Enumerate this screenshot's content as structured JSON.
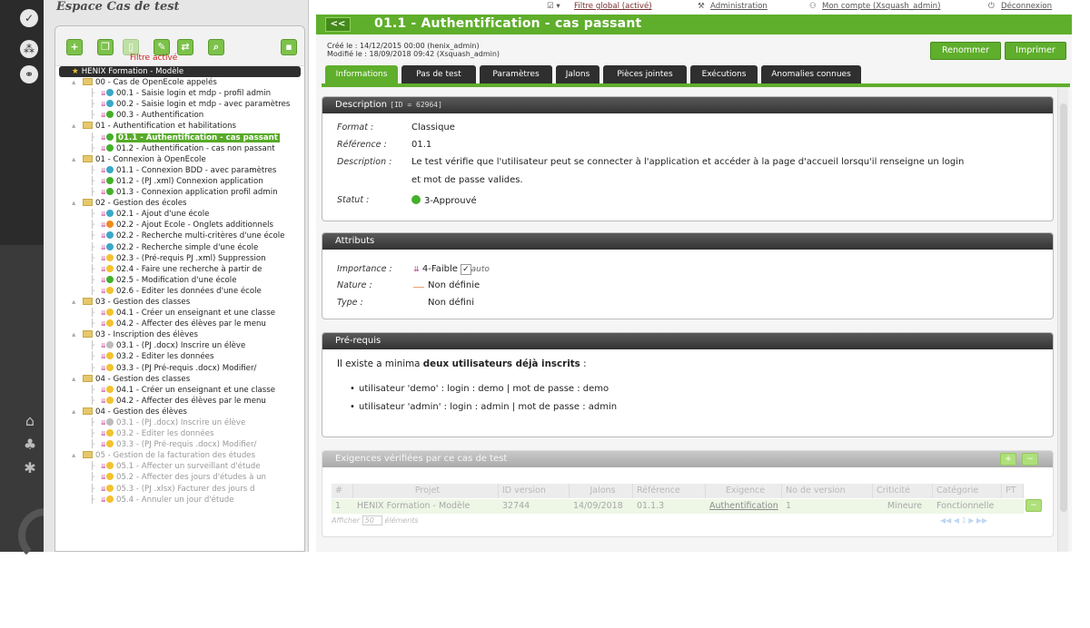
{
  "app": {
    "space_title": "Espace Cas de test",
    "filter_label": "Filtre activé"
  },
  "topbar": {
    "global_filter": "Filtre global (activé)",
    "administration": "Administration",
    "account": "Mon compte (Xsquash_admin)",
    "logout": "Déconnexion"
  },
  "header": {
    "back_label": "<<",
    "title": "01.1 - Authentification - cas passant",
    "created": "Créé le : 14/12/2015 00:00 (henix_admin)",
    "modified": "Modifié le : 18/09/2018 09:42 (Xsquash_admin)",
    "rename_label": "Renommer",
    "print_label": "Imprimer"
  },
  "tabs": [
    "Informations",
    "Pas de test",
    "Paramètres",
    "Jalons",
    "Pièces jointes",
    "Exécutions",
    "Anomalies connues"
  ],
  "description": {
    "heading": "Description",
    "id_label": "[ID = 62964]",
    "format_label": "Format :",
    "format": "Classique",
    "reference_label": "Référence :",
    "reference": "01.1",
    "description_label": "Description :",
    "description_line1": "Le test vérifie que l'utilisateur peut se connecter à l'application et accéder à la page d'accueil lorsqu'il renseigne un login",
    "description_line2": "et mot de passe valides.",
    "status_label": "Statut :",
    "status": "3-Approuvé",
    "status_color": "#43b02a"
  },
  "attributes": {
    "heading": "Attributs",
    "importance_label": "Importance :",
    "importance": "4-Faible",
    "auto_label": "auto",
    "nature_label": "Nature :",
    "nature": "Non définie",
    "type_label": "Type :",
    "type": "Non défini"
  },
  "prerequisites": {
    "heading": "Pré-requis",
    "intro_before": "Il existe a minima ",
    "intro_bold": "deux utilisateurs déjà inscrits",
    "intro_after": " :",
    "bullets": [
      "utilisateur 'demo' : login : demo | mot de passe : demo",
      "utilisateur 'admin' : login : admin | mot de passe : admin"
    ]
  },
  "requirements": {
    "heading": "Exigences vérifiées par ce cas de test",
    "add_label": "+",
    "remove_label": "−",
    "columns": [
      "#",
      "Projet",
      "ID version",
      "Jalons",
      "Référence",
      "Exigence",
      "No de version",
      "Criticité",
      "Catégorie",
      "PT"
    ],
    "rows": [
      [
        "1",
        "HENIX Formation - Modèle",
        "32744",
        "14/09/2018",
        "01.1.3",
        "Authentification",
        "1",
        "Mineure",
        "Fonctionnelle"
      ]
    ],
    "show_label": "Afficher",
    "page_size": "50",
    "elements_label": "éléments",
    "page_number": "1"
  },
  "tree": {
    "toolbar_icons": [
      "add-icon",
      "copy-icon",
      "paste-icon",
      "edit-icon",
      "link-icon",
      "search-icon",
      "delete-icon"
    ],
    "rows": [
      {
        "level": 0,
        "kind": "root",
        "label": "HENIX Formation - Modèle"
      },
      {
        "level": 1,
        "kind": "folder",
        "label": "00 - Cas de OpenEcole appelés"
      },
      {
        "level": 2,
        "kind": "case",
        "color": "#3aa8c8",
        "label": "00.1 - Saisie login et mdp - profil admin"
      },
      {
        "level": 2,
        "kind": "case",
        "color": "#3aa8c8",
        "label": "00.2 - Saisie login et mdp - avec paramètres"
      },
      {
        "level": 2,
        "kind": "case",
        "color": "#43b02a",
        "label": "00.3 - Authentification"
      },
      {
        "level": 1,
        "kind": "folder",
        "label": "01 - Authentification et habilitations"
      },
      {
        "level": 2,
        "kind": "case",
        "color": "#43b02a",
        "label": "01.1 - Authentification - cas passant",
        "selected": true
      },
      {
        "level": 2,
        "kind": "case",
        "color": "#43b02a",
        "label": "01.2 - Authentification - cas non passant"
      },
      {
        "level": 1,
        "kind": "folder",
        "label": "01 - Connexion à OpenEcole"
      },
      {
        "level": 2,
        "kind": "case",
        "color": "#3aa8c8",
        "label": "01.1 - Connexion BDD - avec paramètres"
      },
      {
        "level": 2,
        "kind": "case",
        "color": "#43b02a",
        "label": "01.2 - (PJ .xml) Connexion application"
      },
      {
        "level": 2,
        "kind": "case",
        "color": "#43b02a",
        "label": "01.3 - Connexion application profil admin"
      },
      {
        "level": 1,
        "kind": "folder",
        "label": "02 - Gestion des écoles"
      },
      {
        "level": 2,
        "kind": "case",
        "color": "#3aa8c8",
        "label": "02.1 - Ajout d'une école"
      },
      {
        "level": 2,
        "kind": "case",
        "color": "#f08a1c",
        "label": "02.2 - Ajout Ecole - Onglets additionnels"
      },
      {
        "level": 2,
        "kind": "case",
        "color": "#3aa8c8",
        "label": "02.2 - Recherche multi-critères d'une école"
      },
      {
        "level": 2,
        "kind": "case",
        "color": "#3aa8c8",
        "label": "02.2 - Recherche simple d'une école"
      },
      {
        "level": 2,
        "kind": "case",
        "color": "#f2c22f",
        "label": "02.3 - (Pré-requis PJ .xml) Suppression"
      },
      {
        "level": 2,
        "kind": "case",
        "color": "#f2c22f",
        "label": "02.4 - Faire une recherche à partir de"
      },
      {
        "level": 2,
        "kind": "case",
        "color": "#43b02a",
        "label": "02.5 - Modification d'une école"
      },
      {
        "level": 2,
        "kind": "case",
        "color": "#f2c22f",
        "label": "02.6 - Editer les données d'une école"
      },
      {
        "level": 1,
        "kind": "folder",
        "label": "03 - Gestion des classes"
      },
      {
        "level": 2,
        "kind": "case",
        "color": "#f2c22f",
        "label": "04.1 - Créer un enseignant et une classe"
      },
      {
        "level": 2,
        "kind": "case",
        "color": "#f2c22f",
        "label": "04.2 - Affecter des élèves par le menu"
      },
      {
        "level": 1,
        "kind": "folder",
        "label": "03 - Inscription des élèves"
      },
      {
        "level": 2,
        "kind": "case",
        "color": "#bbbbbb",
        "label": "03.1 - (PJ .docx) Inscrire un élève"
      },
      {
        "level": 2,
        "kind": "case",
        "color": "#f2c22f",
        "label": "03.2 - Editer les données"
      },
      {
        "level": 2,
        "kind": "case",
        "color": "#f2c22f",
        "label": "03.3 - (PJ Pré-requis .docx) Modifier/"
      },
      {
        "level": 1,
        "kind": "folder",
        "label": "04 - Gestion des classes"
      },
      {
        "level": 2,
        "kind": "case",
        "color": "#f2c22f",
        "label": "04.1 - Créer un enseignant et une classe"
      },
      {
        "level": 2,
        "kind": "case",
        "color": "#f2c22f",
        "label": "04.2 - Affecter des élèves par le menu"
      },
      {
        "level": 1,
        "kind": "folder",
        "label": "04 - Gestion des élèves"
      },
      {
        "level": 2,
        "kind": "case",
        "color": "#bbbbbb",
        "label": "03.1 - (PJ .docx) Inscrire un élève",
        "dim": true
      },
      {
        "level": 2,
        "kind": "case",
        "color": "#f2c22f",
        "label": "03.2 - Editer les données",
        "dim": true
      },
      {
        "level": 2,
        "kind": "case",
        "color": "#f2c22f",
        "label": "03.3 - (PJ Pré-requis .docx) Modifier/",
        "dim": true
      },
      {
        "level": 1,
        "kind": "folder",
        "label": "05 - Gestion de la facturation des études",
        "dim": true
      },
      {
        "level": 2,
        "kind": "case",
        "color": "#f2c22f",
        "label": "05.1 - Affecter un surveillant d'étude",
        "dim": true
      },
      {
        "level": 2,
        "kind": "case",
        "color": "#f2c22f",
        "label": "05.2 - Affecter des jours d'études à un",
        "dim": true
      },
      {
        "level": 2,
        "kind": "case",
        "color": "#f2c22f",
        "label": "05.3 - (PJ .xlsx) Facturer des jours d",
        "dim": true
      },
      {
        "level": 2,
        "kind": "case",
        "color": "#f2c22f",
        "label": "05.4 - Annuler un jour d'étude",
        "dim": true
      }
    ]
  },
  "colors": {
    "accent_green": "#5fae2c",
    "dark_tab": "#2f2f2f",
    "link_red": "#7a2f2f"
  }
}
